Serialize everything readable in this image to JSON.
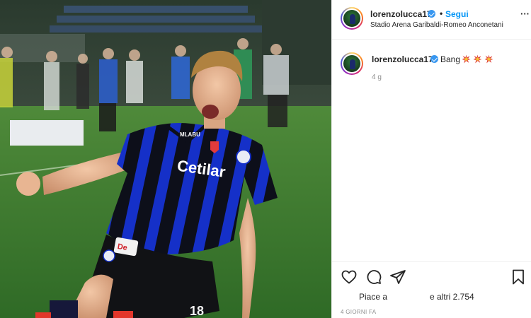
{
  "post": {
    "header": {
      "username": "lorenzolucca17",
      "separator": "•",
      "follow_label": "Segui",
      "location": "Stadio Arena Garibaldi-Romeo Anconetani",
      "more_label": "···"
    },
    "caption": {
      "username": "lorenzolucca17",
      "text": "Bang",
      "emoji": [
        "collision-emoji",
        "collision-emoji",
        "collision-emoji"
      ],
      "time": "4 g"
    },
    "actions": {
      "icons": [
        "heart-icon",
        "comment-icon",
        "share-icon",
        "save-icon"
      ],
      "liked_by": "Piace a",
      "others": "e altri 2.754",
      "date": "4 GIORNI FA"
    },
    "photo": {
      "sponsor": "Cetilar",
      "kit_brand": "MLABU",
      "shorts_sponsor": "De",
      "short_number": "18"
    },
    "colors": {
      "link": "#0095f6",
      "verified": "#3897f0",
      "text": "#262626",
      "muted": "#8e8e8e",
      "jersey_blue": "#1530c8",
      "jersey_black": "#0d0f1a",
      "pitch_green": "#3d7a2e"
    }
  }
}
